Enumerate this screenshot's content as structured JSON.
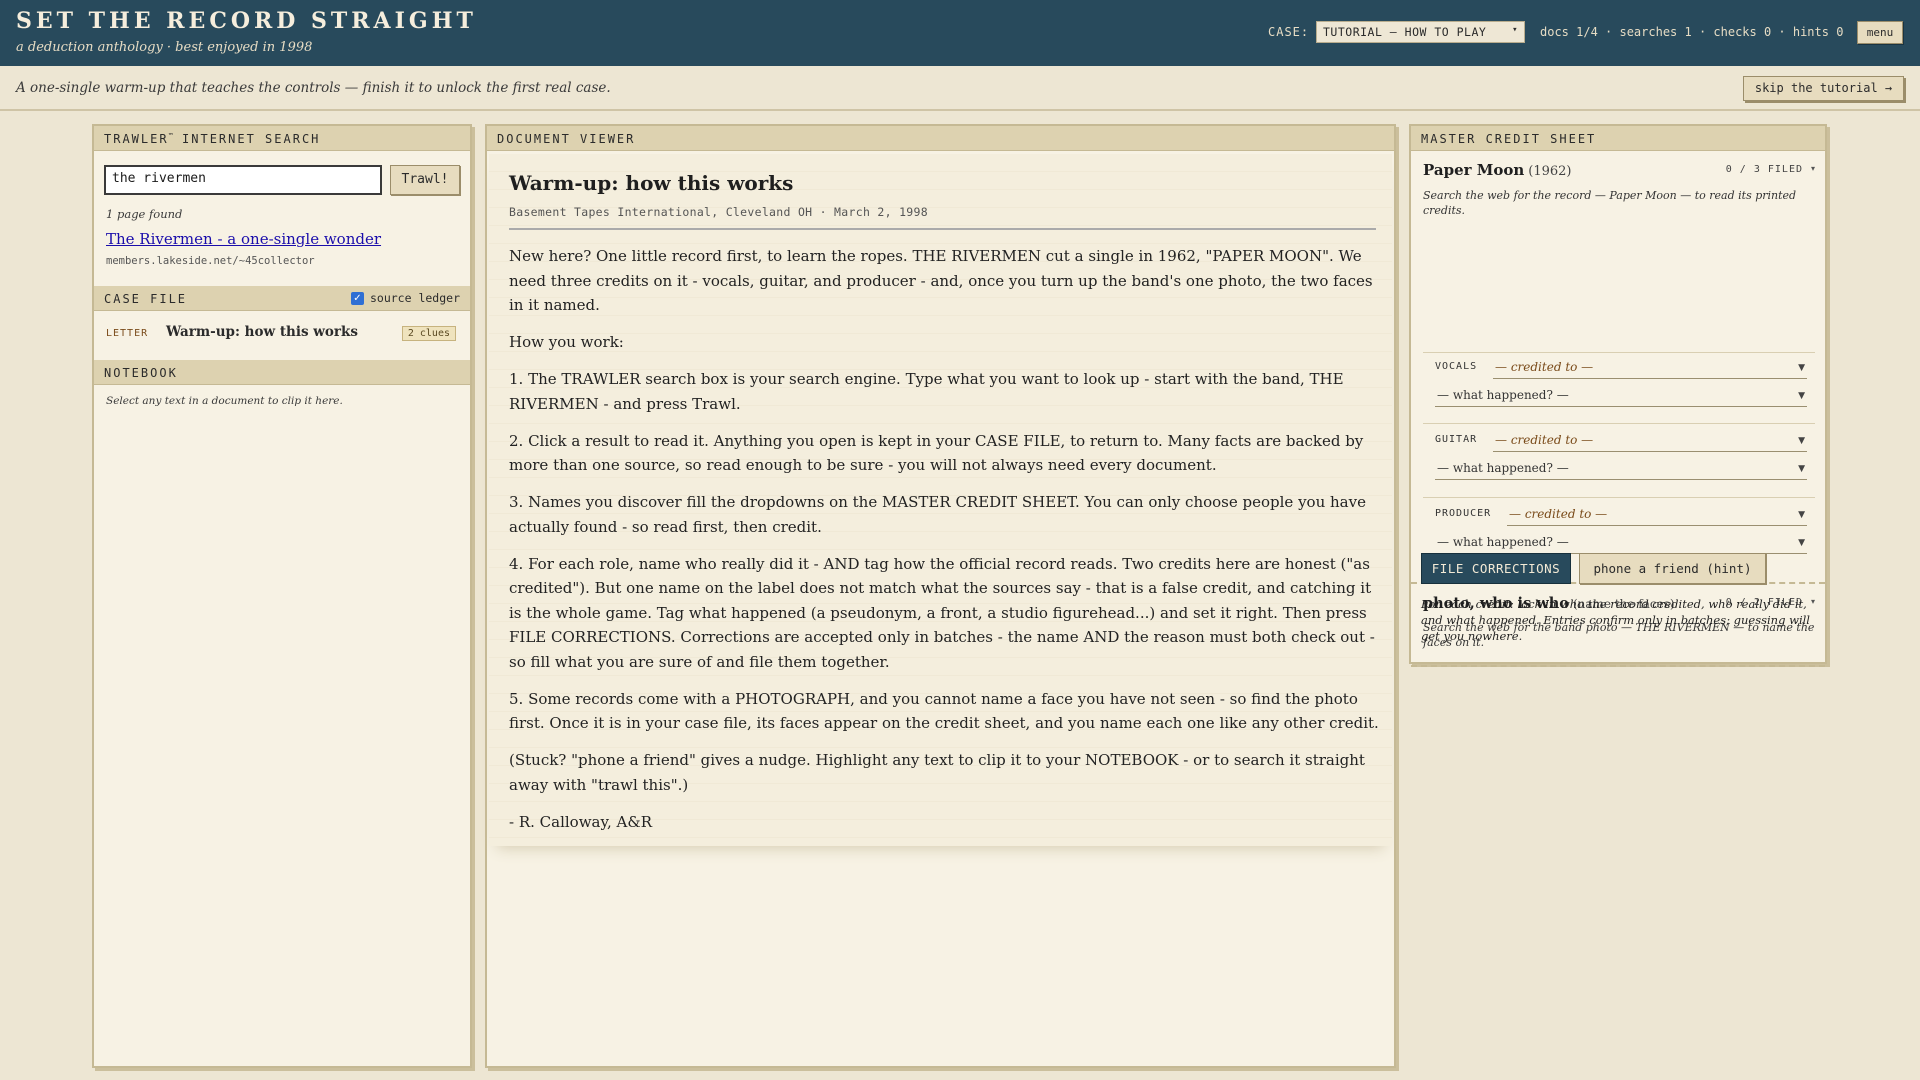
{
  "header": {
    "title": "SET THE RECORD STRAIGHT",
    "subtitle": "a deduction anthology · best enjoyed in 1998",
    "case_label": "CASE:",
    "case_selected": "TUTORIAL — HOW TO PLAY",
    "stats": "docs 1/4 · searches 1 · checks 0 · hints 0",
    "menu_label": "menu"
  },
  "subheader": {
    "intro": "A one-single warm-up that teaches the controls — finish it to unlock the first real case.",
    "skip_label": "skip the tutorial →"
  },
  "search": {
    "panel_title": "TRAWLER",
    "panel_title_mark": "™",
    "panel_title_rest": "INTERNET SEARCH",
    "query": "the rivermen",
    "button_label": "Trawl!",
    "results_count": "1 page found",
    "results": [
      {
        "title": "The Rivermen - a one-single wonder",
        "url": "members.lakeside.net/~45collector"
      }
    ]
  },
  "case_file": {
    "title": "CASE FILE",
    "toggle_label": "source ledger",
    "toggle_checked": true,
    "items": [
      {
        "type": "LETTER",
        "name": "Warm-up: how this works",
        "badge": "2 clues"
      }
    ]
  },
  "notebook": {
    "title": "NOTEBOOK",
    "hint": "Select any text in a document to clip it here."
  },
  "document": {
    "panel_title": "DOCUMENT VIEWER",
    "title": "Warm-up: how this works",
    "meta": "Basement Tapes International, Cleveland OH · March 2, 1998",
    "paragraphs": [
      "New here? One little record first, to learn the ropes. THE RIVERMEN cut a single in 1962, \"PAPER MOON\". We need three credits on it - vocals, guitar, and producer - and, once you turn up the band's one photo, the two faces in it named.",
      "How you work:",
      "1. The TRAWLER search box is your search engine. Type what you want to look up - start with the band, THE RIVERMEN - and press Trawl.",
      "2. Click a result to read it. Anything you open is kept in your CASE FILE, to return to. Many facts are backed by more than one source, so read enough to be sure - you will not always need every document.",
      "3. Names you discover fill the dropdowns on the MASTER CREDIT SHEET. You can only choose people you have actually found - so read first, then credit.",
      "4. For each role, name who really did it - AND tag how the official record reads. Two credits here are honest (\"as credited\"). But one name on the label does not match what the sources say - that is a false credit, and catching it is the whole game. Tag what happened (a pseudonym, a front, a studio figurehead...) and set it right. Then press FILE CORRECTIONS. Corrections are accepted only in batches - the name AND the reason must both check out - so fill what you are sure of and file them together.",
      "5. Some records come with a PHOTOGRAPH, and you cannot name a face you have not seen - so find the photo first. Once it is in your case file, its faces appear on the credit sheet, and you name each one like any other credit.",
      "(Stuck? \"phone a friend\" gives a nudge. Highlight any text to clip it to your NOTEBOOK - or to search it straight away with \"trawl this\".)",
      "- R. Calloway, A&R"
    ]
  },
  "credit_sheet": {
    "panel_title": "MASTER CREDIT SHEET",
    "record": {
      "title": "Paper Moon",
      "year": "(1962)",
      "filed": "0 / 3 FILED",
      "desc": "Search the web for the record — Paper Moon — to read its printed credits."
    },
    "credits": [
      {
        "role": "VOCALS",
        "credited_placeholder": "— credited to —",
        "happened_placeholder": "— what happened? —"
      },
      {
        "role": "GUITAR",
        "credited_placeholder": "— credited to —",
        "happened_placeholder": "— what happened? —"
      },
      {
        "role": "PRODUCER",
        "credited_placeholder": "— credited to —",
        "happened_placeholder": "— what happened? —"
      }
    ],
    "photo": {
      "title": "photo, who is who",
      "subtitle": "(name the faces)",
      "filed": "0 / 2 FILED",
      "desc": "Search the web for the band photo — THE RIVERMEN — to name the faces on it."
    },
    "file_button": "FILE CORRECTIONS",
    "hint_button": "phone a friend (hint)",
    "note": "For each credit: lock in who the record credited, who really did it, and what happened. Entries confirm only in batches; guessing will get you nowhere."
  },
  "icons": {
    "caret": "chevron-down-icon",
    "check": "check-icon"
  },
  "colors": {
    "header_bg": "#284a5c",
    "paper": "#f7f2e4",
    "panel_head": "#ddd2b0",
    "link": "#1a0dab",
    "accent_brown": "#7a4b1a"
  }
}
